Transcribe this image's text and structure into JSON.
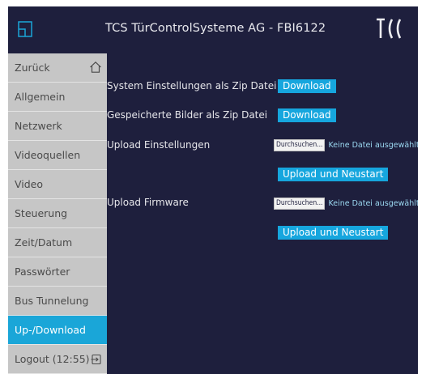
{
  "header": {
    "title": "TCS TürControlSysteme AG - FBI6122",
    "logo_text": "TCS"
  },
  "sidebar": {
    "items": [
      {
        "label": "Zurück"
      },
      {
        "label": "Allgemein"
      },
      {
        "label": "Netzwerk"
      },
      {
        "label": "Videoquellen"
      },
      {
        "label": "Video"
      },
      {
        "label": "Steuerung"
      },
      {
        "label": "Zeit/Datum"
      },
      {
        "label": "Passwörter"
      },
      {
        "label": "Bus Tunnelung"
      },
      {
        "label": "Up-/Download"
      },
      {
        "label": "Logout (12:55)"
      }
    ]
  },
  "main": {
    "system_label": "System Einstellungen als Zip Datei",
    "system_download": "Download",
    "images_label": "Gespeicherte Bilder als Zip Datei",
    "images_download": "Download",
    "upload_settings_label": "Upload Einstellungen",
    "upload_firmware_label": "Upload Firmware",
    "browse_label": "Durchsuchen...",
    "no_file_text": "Keine Datei ausgewählt.",
    "upload_restart": "Upload und Neustart"
  },
  "colors": {
    "background": "#1e1f3d",
    "accent": "#16a6de",
    "nav": "#c6c6c6"
  },
  "icons": {
    "app": "window-icon",
    "home": "home-icon",
    "logout": "logout-icon"
  }
}
